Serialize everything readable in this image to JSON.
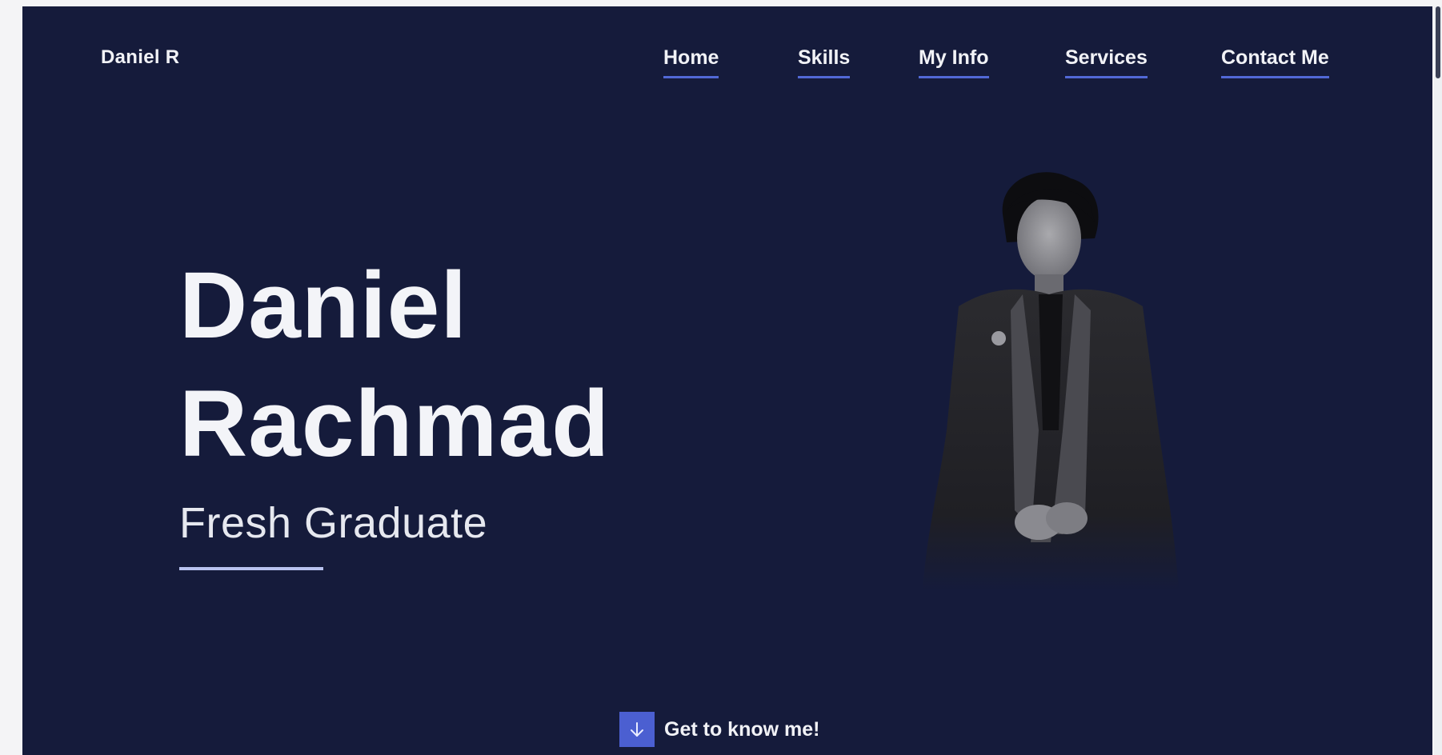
{
  "brand": "Daniel R",
  "nav": {
    "items": [
      {
        "label": "Home"
      },
      {
        "label": "Skills"
      },
      {
        "label": "My Info"
      },
      {
        "label": "Services"
      },
      {
        "label": "Contact Me"
      }
    ]
  },
  "hero": {
    "first_name": "Daniel",
    "last_name": "Rachmad",
    "role": "Fresh Graduate"
  },
  "cta": {
    "label": "Get to know me!",
    "icon": "arrow-down-icon"
  },
  "colors": {
    "background": "#151b3b",
    "accent": "#4b5fd1",
    "underline": "#5168d6",
    "text": "#f1f2f6"
  }
}
